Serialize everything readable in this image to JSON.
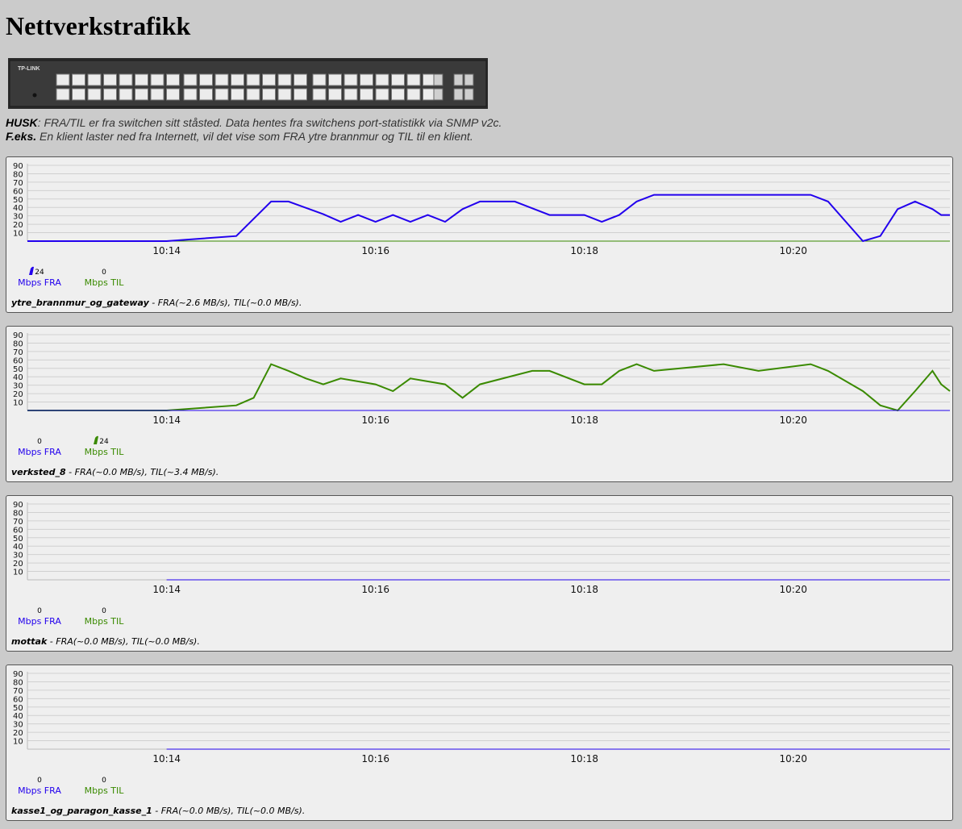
{
  "page": {
    "title": "Nettverkstrafikk",
    "note1_strong": "HUSK",
    "note1_text": ": FRA/TIL er fra switchen sitt ståsted. Data hentes fra switchens port-statistikk via SNMP v2c.",
    "note2_strong": "F.eks.",
    "note2_text": " En klient laster ned fra Internett, vil det vise som FRA ytre brannmur og TIL til en klient.",
    "switch_brand": "TP-LINK"
  },
  "colors": {
    "fra": "#2200ee",
    "til": "#3a8a00",
    "background": "#cbcbcb",
    "panel": "#efefef"
  },
  "gauge_labels": {
    "fra": "Mbps FRA",
    "til": "Mbps TIL"
  },
  "panels": [
    {
      "port": "ytre_brannmur_og_gateway",
      "info": " - FRA(~2.6 MB/s), TIL(~0.0 MB/s).",
      "fra_value": "24",
      "til_value": "0",
      "active_gauge": "fra"
    },
    {
      "port": "verksted_8",
      "info": " - FRA(~0.0 MB/s), TIL(~3.4 MB/s).",
      "fra_value": "0",
      "til_value": "24",
      "active_gauge": "til"
    },
    {
      "port": "mottak",
      "info": " - FRA(~0.0 MB/s), TIL(~0.0 MB/s).",
      "fra_value": "0",
      "til_value": "0",
      "active_gauge": "none"
    },
    {
      "port": "kasse1_og_paragon_kasse_1",
      "info": " - FRA(~0.0 MB/s), TIL(~0.0 MB/s).",
      "fra_value": "0",
      "til_value": "0",
      "active_gauge": "none"
    }
  ],
  "chart_data": [
    {
      "type": "line",
      "title": "ytre_brannmur_og_gateway",
      "ylim": [
        0,
        90
      ],
      "yticks": [
        10,
        20,
        30,
        40,
        50,
        60,
        70,
        80,
        90
      ],
      "xtick_labels": [
        "10:14",
        "10:16",
        "10:18",
        "10:20"
      ],
      "xlim": [
        "10:12:40",
        "10:21:30"
      ],
      "series": [
        {
          "color": "#2200ee",
          "x": [
            "10:12:40",
            "10:14:00",
            "10:14:40",
            "10:15:00",
            "10:15:10",
            "10:15:30",
            "10:15:40",
            "10:15:50",
            "10:16:00",
            "10:16:10",
            "10:16:20",
            "10:16:30",
            "10:16:40",
            "10:16:50",
            "10:17:00",
            "10:17:20",
            "10:17:40",
            "10:18:00",
            "10:18:10",
            "10:18:20",
            "10:18:30",
            "10:18:40",
            "10:20:10",
            "10:20:20",
            "10:20:40",
            "10:20:50",
            "10:21:00",
            "10:21:10",
            "10:21:20",
            "10:21:25",
            "10:21:30"
          ],
          "y": [
            0,
            0,
            6,
            47,
            47,
            32,
            23,
            31,
            23,
            31,
            23,
            31,
            23,
            38,
            47,
            47,
            31,
            31,
            23,
            31,
            47,
            55,
            55,
            47,
            0,
            6,
            38,
            47,
            38,
            31,
            31
          ]
        },
        {
          "color": "#3a8a00",
          "x": [
            "10:12:40",
            "10:14:00",
            "10:21:30"
          ],
          "y": [
            0,
            0,
            0
          ]
        }
      ]
    },
    {
      "type": "line",
      "title": "verksted_8",
      "ylim": [
        0,
        90
      ],
      "yticks": [
        10,
        20,
        30,
        40,
        50,
        60,
        70,
        80,
        90
      ],
      "xtick_labels": [
        "10:14",
        "10:16",
        "10:18",
        "10:20"
      ],
      "xlim": [
        "10:12:40",
        "10:21:30"
      ],
      "series": [
        {
          "color": "#2200ee",
          "x": [
            "10:12:40",
            "10:14:00",
            "10:21:30"
          ],
          "y": [
            0,
            0,
            0
          ]
        },
        {
          "color": "#3a8a00",
          "x": [
            "10:12:40",
            "10:14:00",
            "10:14:40",
            "10:14:50",
            "10:15:00",
            "10:15:10",
            "10:15:20",
            "10:15:30",
            "10:15:40",
            "10:16:00",
            "10:16:10",
            "10:16:20",
            "10:16:40",
            "10:16:50",
            "10:17:00",
            "10:17:30",
            "10:17:40",
            "10:18:00",
            "10:18:10",
            "10:18:20",
            "10:18:30",
            "10:18:40",
            "10:19:20",
            "10:19:40",
            "10:20:10",
            "10:20:20",
            "10:20:40",
            "10:20:50",
            "10:21:00",
            "10:21:10",
            "10:21:20",
            "10:21:25",
            "10:21:30"
          ],
          "y": [
            0,
            0,
            6,
            15,
            55,
            47,
            38,
            31,
            38,
            31,
            23,
            38,
            31,
            15,
            31,
            47,
            47,
            31,
            31,
            47,
            55,
            47,
            55,
            47,
            55,
            47,
            23,
            6,
            0,
            23,
            47,
            31,
            23
          ]
        }
      ]
    },
    {
      "type": "line",
      "title": "mottak",
      "ylim": [
        0,
        90
      ],
      "yticks": [
        10,
        20,
        30,
        40,
        50,
        60,
        70,
        80,
        90
      ],
      "xtick_labels": [
        "10:14",
        "10:16",
        "10:18",
        "10:20"
      ],
      "xlim": [
        "10:12:40",
        "10:21:30"
      ],
      "series": [
        {
          "color": "#2200ee",
          "x": [
            "10:14:00",
            "10:21:30"
          ],
          "y": [
            0,
            0
          ]
        },
        {
          "color": "#3a8a00",
          "x": [
            "10:14:00",
            "10:21:30"
          ],
          "y": [
            0,
            0
          ]
        }
      ]
    },
    {
      "type": "line",
      "title": "kasse1_og_paragon_kasse_1",
      "ylim": [
        0,
        90
      ],
      "yticks": [
        10,
        20,
        30,
        40,
        50,
        60,
        70,
        80,
        90
      ],
      "xtick_labels": [
        "10:14",
        "10:16",
        "10:18",
        "10:20"
      ],
      "xlim": [
        "10:12:40",
        "10:21:30"
      ],
      "series": [
        {
          "color": "#2200ee",
          "x": [
            "10:14:00",
            "10:21:30"
          ],
          "y": [
            0,
            0
          ]
        },
        {
          "color": "#3a8a00",
          "x": [
            "10:14:00",
            "10:21:30"
          ],
          "y": [
            0,
            0
          ]
        }
      ]
    }
  ]
}
